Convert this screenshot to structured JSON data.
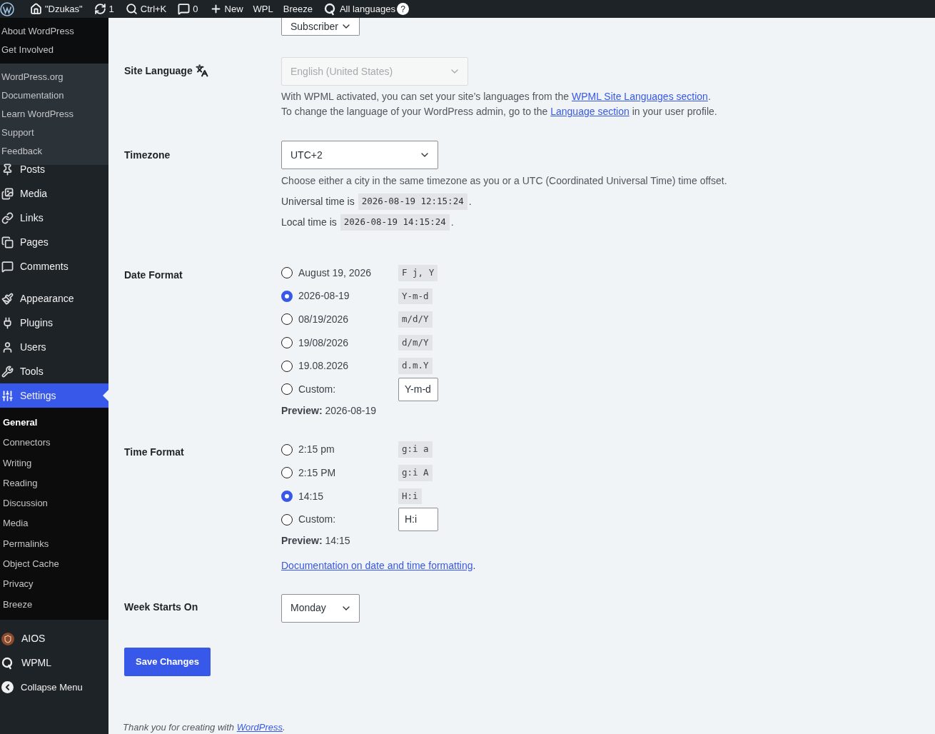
{
  "admin_bar": {
    "items": [
      {
        "kind": "logo"
      },
      {
        "kind": "home",
        "label": "\"Dzukas\""
      },
      {
        "kind": "updates",
        "label": "1"
      },
      {
        "kind": "search",
        "label": "Ctrl+K"
      },
      {
        "kind": "comments",
        "label": "0"
      },
      {
        "kind": "new",
        "label": "New"
      },
      {
        "kind": "text",
        "label": "WPL"
      },
      {
        "kind": "text",
        "label": "Breeze"
      },
      {
        "kind": "languages",
        "label": "All languages",
        "help": "?"
      }
    ]
  },
  "logo_menu": {
    "groups": [
      [
        "About WordPress",
        "Get Involved"
      ],
      [
        "WordPress.org",
        "Documentation",
        "Learn WordPress",
        "Support",
        "Feedback"
      ]
    ]
  },
  "sidebar": {
    "groups": [
      [
        {
          "kind": "posts",
          "label": "Posts",
          "selected": false
        },
        {
          "kind": "media",
          "label": "Media",
          "selected": false
        },
        {
          "kind": "links",
          "label": "Links",
          "selected": false
        },
        {
          "kind": "pages",
          "label": "Pages",
          "selected": false
        },
        {
          "kind": "comments",
          "label": "Comments",
          "selected": false
        }
      ],
      [
        {
          "kind": "appearance",
          "label": "Appearance",
          "selected": false
        },
        {
          "kind": "plugins",
          "label": "Plugins",
          "selected": false
        },
        {
          "kind": "users",
          "label": "Users",
          "selected": false
        },
        {
          "kind": "tools",
          "label": "Tools",
          "selected": false
        },
        {
          "kind": "settings",
          "label": "Settings",
          "selected": true
        }
      ]
    ],
    "submenu": [
      {
        "label": "General",
        "selected": true
      },
      {
        "label": "Connectors",
        "selected": false
      },
      {
        "label": "Writing",
        "selected": false
      },
      {
        "label": "Reading",
        "selected": false
      },
      {
        "label": "Discussion",
        "selected": false
      },
      {
        "label": "Media",
        "selected": false
      },
      {
        "label": "Permalinks",
        "selected": false
      },
      {
        "label": "Object Cache",
        "selected": false
      },
      {
        "label": "Privacy",
        "selected": false
      },
      {
        "label": "Breeze",
        "selected": false
      }
    ],
    "bottom": [
      {
        "kind": "aios",
        "label": "AIOS"
      },
      {
        "kind": "wpml",
        "label": "WPML"
      },
      {
        "kind": "collapse",
        "label": "Collapse Menu"
      }
    ]
  },
  "form": {
    "default_role": {
      "value": "Subscriber"
    },
    "site_language": {
      "label": "Site Language",
      "value": "English (United States)",
      "disabled": true,
      "description": [
        {
          "before": "With WPML activated, you can set your site’s languages from the ",
          "link": "WPML Site Languages section",
          "after": "."
        },
        {
          "before": "To change the language of your WordPress admin, go to the ",
          "link": "Language section",
          "after": " in your user profile."
        }
      ]
    },
    "timezone": {
      "label": "Timezone",
      "value": "UTC+2",
      "description": "Choose either a city in the same timezone as you or a UTC (Coordinated Universal Time) time offset.",
      "times": [
        {
          "label": "Universal time is",
          "value": "2026-08-19 12:15:24",
          "suffix": "."
        },
        {
          "label": "Local time is",
          "value": "2026-08-19 14:15:24",
          "suffix": "."
        }
      ]
    },
    "date_format": {
      "label": "Date Format",
      "options": [
        {
          "kind": "preset",
          "label": "August 19, 2026",
          "code": "F j, Y",
          "selected": false
        },
        {
          "kind": "preset",
          "label": "2026-08-19",
          "code": "Y-m-d",
          "selected": true
        },
        {
          "kind": "preset",
          "label": "08/19/2026",
          "code": "m/d/Y",
          "selected": false
        },
        {
          "kind": "preset",
          "label": "19/08/2026",
          "code": "d/m/Y",
          "selected": false
        },
        {
          "kind": "preset",
          "label": "19.08.2026",
          "code": "d.m.Y",
          "selected": false
        },
        {
          "kind": "custom",
          "label": "Custom:",
          "value": "Y-m-d",
          "selected": false
        }
      ],
      "preview_label": "Preview:",
      "preview": "2026-08-19"
    },
    "time_format": {
      "label": "Time Format",
      "options": [
        {
          "kind": "preset",
          "label": "2:15 pm",
          "code": "g:i a",
          "selected": false
        },
        {
          "kind": "preset",
          "label": "2:15 PM",
          "code": "g:i A",
          "selected": false
        },
        {
          "kind": "preset",
          "label": "14:15",
          "code": "H:i",
          "selected": true
        },
        {
          "kind": "custom",
          "label": "Custom:",
          "value": "H:i",
          "selected": false
        }
      ],
      "preview_label": "Preview:",
      "preview": "14:15",
      "doc_link": "Documentation on date and time formatting",
      "doc_suffix": "."
    },
    "week_start": {
      "label": "Week Starts On",
      "value": "Monday"
    },
    "save": "Save Changes"
  },
  "footer": {
    "before": "Thank you for creating with ",
    "link": "WordPress",
    "after": "."
  }
}
